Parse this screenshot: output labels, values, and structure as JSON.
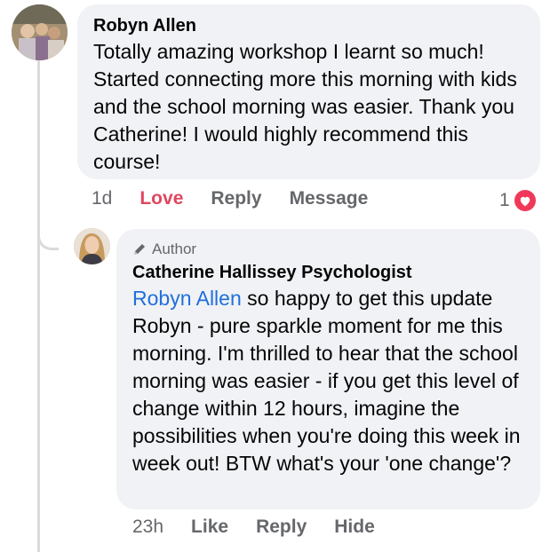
{
  "comment": {
    "author": "Robyn Allen",
    "text": "Totally amazing workshop I learnt so much! Started connecting more this morning with kids and the school morning was easier. Thank you Catherine! I would highly recommend this course!",
    "time": "1d",
    "actions": {
      "love": "Love",
      "reply": "Reply",
      "message": "Message"
    },
    "reaction_count": "1",
    "reaction_type": "heart-icon"
  },
  "reply": {
    "badge": "Author",
    "author": "Catherine Hallissey Psychologist",
    "mention": "Robyn Allen",
    "text": " so happy to get this update Robyn - pure sparkle moment for me this morning. I'm thrilled to hear that the school morning was easier - if you get this level of change within 12 hours, imagine the possibilities when you're doing this week in week out! BTW what's your 'one change'?",
    "time": "23h",
    "actions": {
      "like": "Like",
      "reply": "Reply",
      "hide": "Hide"
    }
  },
  "colors": {
    "bubble": "#f0f2f5",
    "mention": "#216fdb",
    "love": "#e0475f",
    "muted": "#65676b"
  }
}
